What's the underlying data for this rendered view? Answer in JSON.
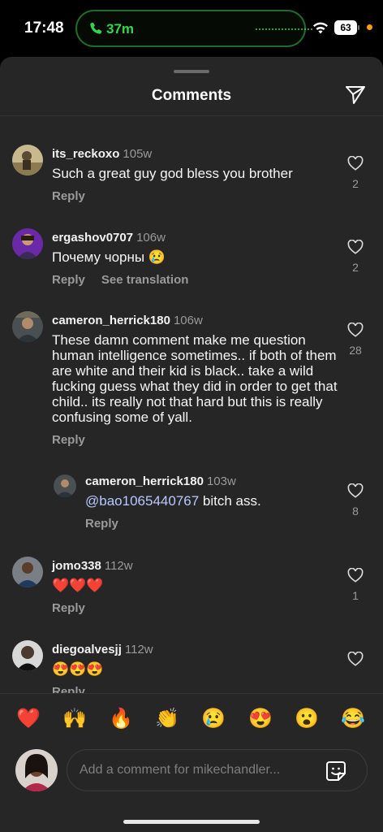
{
  "status_bar": {
    "time": "17:48",
    "call_duration": "37m",
    "battery": "63",
    "call_color": "#32d74b"
  },
  "sheet": {
    "title": "Comments",
    "share_icon": "paper-plane-icon"
  },
  "comments": [
    {
      "username": "its_reckoxo",
      "age": "105w",
      "text": "Such a great guy god bless you brother",
      "actions": [
        "Reply"
      ],
      "likes": "2"
    },
    {
      "username": "ergashov0707",
      "age": "106w",
      "text": "Почему чорны 😢",
      "actions": [
        "Reply",
        "See translation"
      ],
      "likes": "2"
    },
    {
      "username": "cameron_herrick180",
      "age": "106w",
      "text": "These damn comment make me question human intelligence sometimes.. if both of them are white and their kid is black.. take a wild fucking guess what they did in order to get that child.. its really not that hard but this is really confusing some of yall.",
      "actions": [
        "Reply"
      ],
      "likes": "28"
    },
    {
      "username": "cameron_herrick180",
      "age": "103w",
      "mention": "@bao1065440767",
      "text": " bitch ass.",
      "actions": [
        "Reply"
      ],
      "likes": "8"
    },
    {
      "username": "jomo338",
      "age": "112w",
      "text": "❤️❤️❤️",
      "actions": [
        "Reply"
      ],
      "likes": "1"
    },
    {
      "username": "diegoalvesjj",
      "age": "112w",
      "text": "😍😍😍",
      "actions": [
        "Reply"
      ],
      "likes": ""
    }
  ],
  "quick_reactions": [
    "❤️",
    "🙌",
    "🔥",
    "👏",
    "😢",
    "😍",
    "😮",
    "😂"
  ],
  "composer": {
    "placeholder": "Add a comment for mikechandler...",
    "sticker_icon": "sticker-icon"
  }
}
